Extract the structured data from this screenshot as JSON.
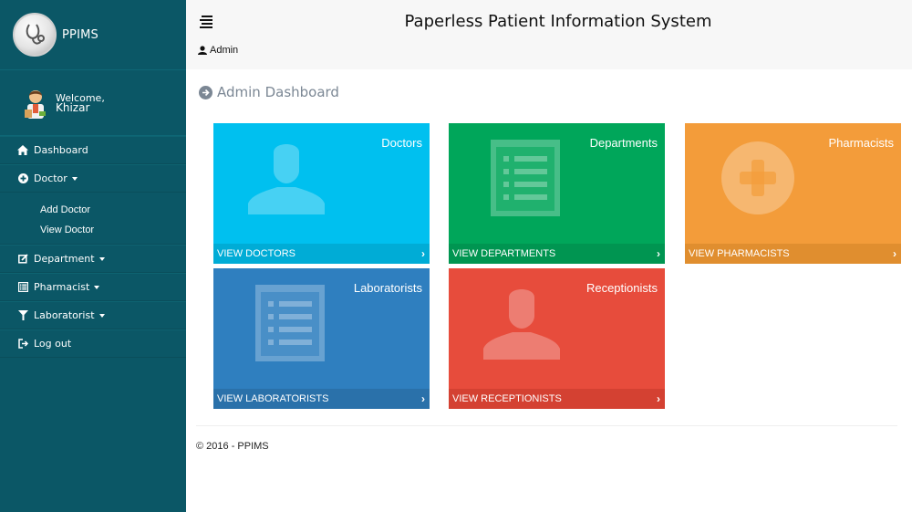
{
  "sidebar": {
    "brand": "PPIMS",
    "welcome": "Welcome,",
    "username": "Khizar",
    "nav": {
      "dashboard": "Dashboard",
      "doctor": "Doctor",
      "add_doctor": "Add Doctor",
      "view_doctor": "View Doctor",
      "department": "Department",
      "pharmacist": "Pharmacist",
      "laboratorist": "Laboratorist",
      "logout": "Log out"
    }
  },
  "header": {
    "title": "Paperless Patient Information System",
    "user": "Admin"
  },
  "main": {
    "page_title": "Admin Dashboard",
    "tiles": {
      "doctors": {
        "label": "Doctors",
        "link": "VIEW DOCTORS"
      },
      "departments": {
        "label": "Departments",
        "link": "VIEW DEPARTMENTS"
      },
      "pharmacists": {
        "label": "Pharmacists",
        "link": "VIEW PHARMACISTS"
      },
      "laboratorists": {
        "label": "Laboratorists",
        "link": "VIEW LABORATORISTS"
      },
      "receptionists": {
        "label": "Receptionists",
        "link": "VIEW RECEPTIONISTS"
      }
    }
  },
  "footer": {
    "copyright": "© 2016 - PPIMS"
  },
  "colors": {
    "sidebar": "#0b5766",
    "doctors": "#00c0ef",
    "departments": "#00a65a",
    "pharmacists": "#f39c3a",
    "laboratorists": "#2f7fbf",
    "receptionists": "#e74c3c"
  }
}
